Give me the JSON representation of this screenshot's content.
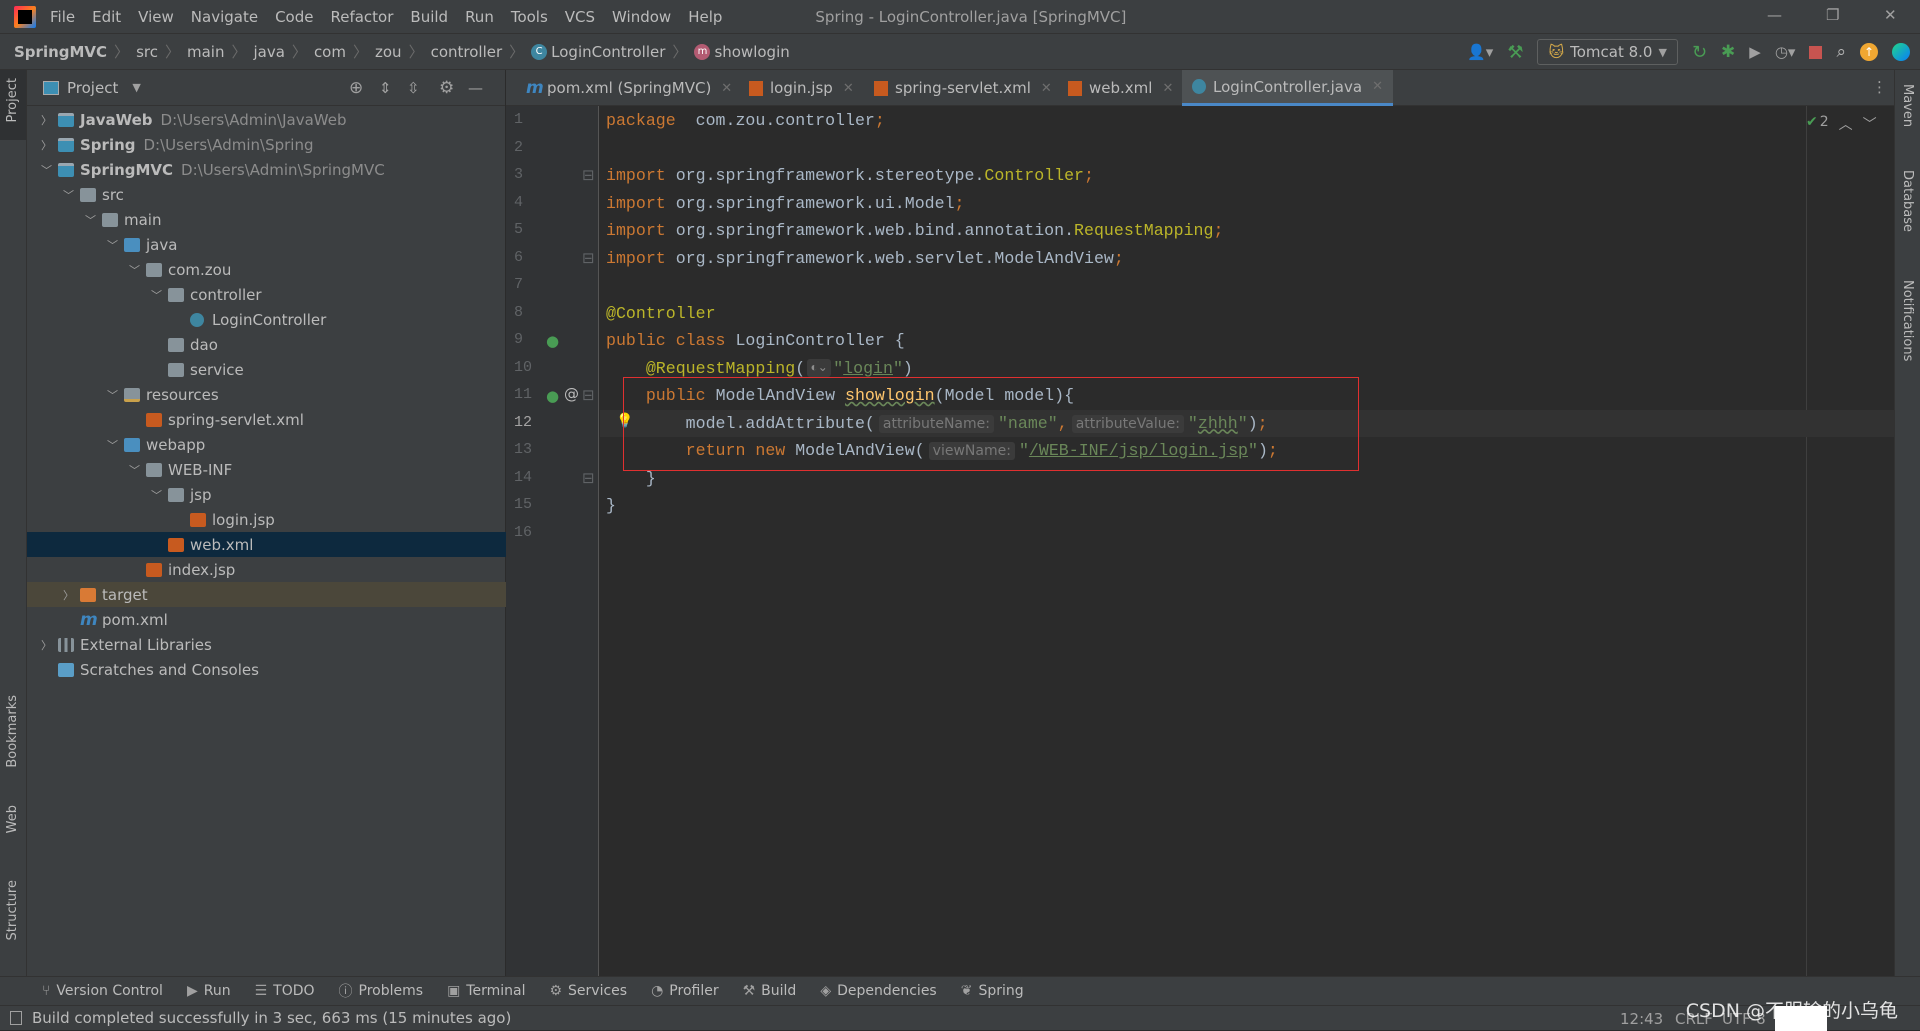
{
  "app": {
    "title": "Spring - LoginController.java [SpringMVC]"
  },
  "menu": [
    "File",
    "Edit",
    "View",
    "Navigate",
    "Code",
    "Refactor",
    "Build",
    "Run",
    "Tools",
    "VCS",
    "Window",
    "Help"
  ],
  "breadcrumb": [
    "SpringMVC",
    "src",
    "main",
    "java",
    "com",
    "zou",
    "controller",
    "LoginController",
    "showlogin"
  ],
  "toolbar": {
    "run_config": "Tomcat 8.0"
  },
  "project_panel": {
    "title": "Project"
  },
  "tree": [
    {
      "label": "JavaWeb",
      "path": "D:\\Users\\Admin\\JavaWeb",
      "level": 0,
      "arrow": "right",
      "icon": "module",
      "bold": true
    },
    {
      "label": "Spring",
      "path": "D:\\Users\\Admin\\Spring",
      "level": 0,
      "arrow": "right",
      "icon": "module",
      "bold": true
    },
    {
      "label": "SpringMVC",
      "path": "D:\\Users\\Admin\\SpringMVC",
      "level": 0,
      "arrow": "down",
      "icon": "module",
      "bold": true
    },
    {
      "label": "src",
      "level": 1,
      "arrow": "down",
      "icon": "folder"
    },
    {
      "label": "main",
      "level": 2,
      "arrow": "down",
      "icon": "folder"
    },
    {
      "label": "java",
      "level": 3,
      "arrow": "down",
      "icon": "source-folder"
    },
    {
      "label": "com.zou",
      "level": 4,
      "arrow": "down",
      "icon": "package"
    },
    {
      "label": "controller",
      "level": 5,
      "arrow": "down",
      "icon": "package"
    },
    {
      "label": "LoginController",
      "level": 6,
      "icon": "class"
    },
    {
      "label": "dao",
      "level": 5,
      "icon": "package"
    },
    {
      "label": "service",
      "level": 5,
      "icon": "package"
    },
    {
      "label": "resources",
      "level": 3,
      "arrow": "down",
      "icon": "resources-folder"
    },
    {
      "label": "spring-servlet.xml",
      "level": 4,
      "icon": "xml"
    },
    {
      "label": "webapp",
      "level": 3,
      "arrow": "down",
      "icon": "web-folder"
    },
    {
      "label": "WEB-INF",
      "level": 4,
      "arrow": "down",
      "icon": "folder"
    },
    {
      "label": "jsp",
      "level": 5,
      "arrow": "down",
      "icon": "folder"
    },
    {
      "label": "login.jsp",
      "level": 6,
      "icon": "jsp"
    },
    {
      "label": "web.xml",
      "level": 5,
      "icon": "xml",
      "selected": true
    },
    {
      "label": "index.jsp",
      "level": 4,
      "icon": "jsp"
    },
    {
      "label": "target",
      "level": 1,
      "arrow": "right",
      "icon": "excluded-folder",
      "highlighted": true
    },
    {
      "label": "pom.xml",
      "level": 1,
      "icon": "maven"
    },
    {
      "label": "External Libraries",
      "level": 0,
      "arrow": "right",
      "icon": "libraries"
    },
    {
      "label": "Scratches and Consoles",
      "level": 0,
      "icon": "scratches"
    }
  ],
  "tabs": [
    {
      "label": "pom.xml (SpringMVC)",
      "icon": "maven"
    },
    {
      "label": "login.jsp",
      "icon": "jsp"
    },
    {
      "label": "spring-servlet.xml",
      "icon": "xml"
    },
    {
      "label": "web.xml",
      "icon": "xml"
    },
    {
      "label": "LoginController.java",
      "icon": "class",
      "active": true
    }
  ],
  "editor": {
    "current_line": 12,
    "inspection_count": "2",
    "lines": [
      [
        [
          "kw",
          "package"
        ],
        [
          "",
          "  com.zou.controller"
        ],
        [
          "kw",
          ";"
        ]
      ],
      [],
      [
        [
          "kw",
          "import"
        ],
        [
          "",
          " org.springframework.stereotype."
        ],
        [
          "ann",
          "Controller"
        ],
        [
          "kw",
          ";"
        ]
      ],
      [
        [
          "kw",
          "import"
        ],
        [
          "",
          " org.springframework.ui.Model"
        ],
        [
          "kw",
          ";"
        ]
      ],
      [
        [
          "kw",
          "import"
        ],
        [
          "",
          " org.springframework.web.bind.annotation."
        ],
        [
          "ann",
          "RequestMapping"
        ],
        [
          "kw",
          ";"
        ]
      ],
      [
        [
          "kw",
          "import"
        ],
        [
          "",
          " org.springframework.web.servlet.ModelAndView"
        ],
        [
          "kw",
          ";"
        ]
      ],
      [],
      [
        [
          "ann",
          "@Controller"
        ]
      ],
      [
        [
          "kw",
          "public class "
        ],
        [
          "",
          "LoginController {"
        ]
      ],
      [
        [
          "",
          "    "
        ],
        [
          "ann",
          "@RequestMapping"
        ],
        [
          "",
          "("
        ],
        [
          "globe",
          "🌐⌄"
        ],
        [
          "str",
          "\""
        ],
        [
          "str ul",
          "login"
        ],
        [
          "str",
          "\""
        ],
        [
          "",
          ")"
        ]
      ],
      [
        [
          "",
          "    "
        ],
        [
          "kw",
          "public "
        ],
        [
          "",
          "ModelAndView "
        ],
        [
          "mth",
          "showlogin"
        ],
        [
          "",
          "(Model model){"
        ]
      ],
      [
        [
          "",
          "        model.addAttribute("
        ],
        [
          "hint",
          "attributeName:"
        ],
        [
          "str",
          "\"name\""
        ],
        [
          "kw",
          ","
        ],
        [
          "hint",
          "attributeValue:"
        ],
        [
          "str",
          "\""
        ],
        [
          "str wv",
          "zhhh"
        ],
        [
          "str",
          "\""
        ],
        [
          "",
          ")"
        ],
        [
          "kw",
          ";"
        ]
      ],
      [
        [
          "",
          "        "
        ],
        [
          "kw",
          "return new "
        ],
        [
          "",
          "ModelAndView("
        ],
        [
          "hint",
          "viewName:"
        ],
        [
          "str",
          "\""
        ],
        [
          "str ul",
          "/WEB-INF/jsp/login.jsp"
        ],
        [
          "str",
          "\""
        ],
        [
          "",
          ")"
        ],
        [
          "kw",
          ";"
        ]
      ],
      [
        [
          "",
          "    }"
        ]
      ],
      [
        [
          "",
          "}"
        ]
      ],
      []
    ]
  },
  "left_stripe": [
    "Project",
    "Bookmarks",
    "Web",
    "Structure"
  ],
  "right_stripe": [
    "Maven",
    "Database",
    "Notifications"
  ],
  "bottom_tools": [
    "Version Control",
    "Run",
    "TODO",
    "Problems",
    "Terminal",
    "Services",
    "Profiler",
    "Build",
    "Dependencies",
    "Spring"
  ],
  "status": {
    "message": "Build completed successfully in 3 sec, 663 ms (15 minutes ago)",
    "position": "12:43",
    "line_separator": "CRLF",
    "encoding": "UTF-8"
  },
  "watermark": "CSDN @不服输的小乌龟"
}
